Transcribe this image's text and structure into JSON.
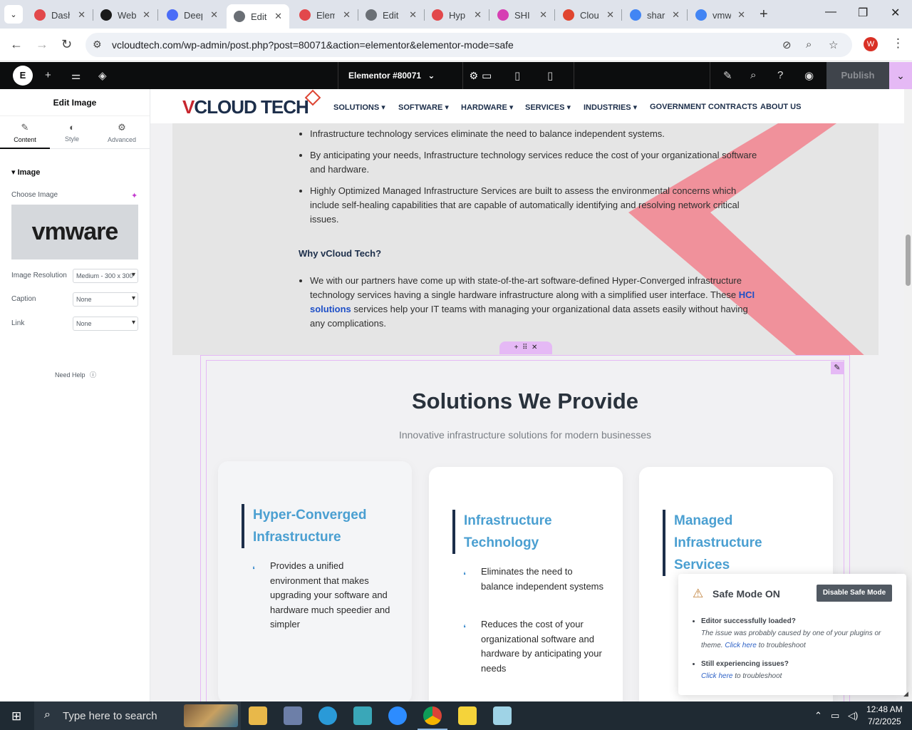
{
  "browser": {
    "tabs": [
      {
        "title": "Dashboard",
        "color": "#e2484b"
      },
      {
        "title": "Web",
        "color": "#1a1a1a"
      },
      {
        "title": "Deep",
        "color": "#4a6cf7"
      },
      {
        "title": "Edit",
        "color": "#6a6f75",
        "active": true
      },
      {
        "title": "Elem",
        "color": "#e2484b"
      },
      {
        "title": "Edit",
        "color": "#6a6f75"
      },
      {
        "title": "Hyp",
        "color": "#e2484b"
      },
      {
        "title": "SHI",
        "color": "#d63fb3"
      },
      {
        "title": "Clou",
        "color": "#e0452f"
      },
      {
        "title": "shar",
        "color": "#4285f4"
      },
      {
        "title": "vmw",
        "color": "#4285f4"
      }
    ],
    "url": "vcloudtech.com/wp-admin/post.php?post=80071&action=elementor&elementor-mode=safe",
    "profile_initial": "W"
  },
  "elementor": {
    "doc_title": "Elementor #80071",
    "publish_label": "Publish"
  },
  "panel": {
    "title": "Edit Image",
    "tabs": [
      "Content",
      "Style",
      "Advanced"
    ],
    "section": "Image",
    "choose_image_label": "Choose Image",
    "preview_logo_text": "vmware",
    "fields": [
      {
        "label": "Image Resolution",
        "value": "Medium - 300 x 300"
      },
      {
        "label": "Caption",
        "value": "None"
      },
      {
        "label": "Link",
        "value": "None"
      }
    ],
    "need_help": "Need Help"
  },
  "site": {
    "logo_v": "V",
    "logo_rest": "CLOUD TECH",
    "menu": [
      "SOLUTIONS",
      "SOFTWARE",
      "HARDWARE",
      "SERVICES",
      "INDUSTRIES",
      "GOVERNMENT CONTRACTS",
      "ABOUT US"
    ],
    "bullets_top": [
      "Infrastructure technology services eliminate the need to balance independent systems.",
      "By anticipating your needs, Infrastructure technology services reduce the cost of your organizational software and hardware.",
      "Highly Optimized Managed Infrastructure Services are built to assess the environmental concerns which include self-healing capabilities that are capable of automatically identifying and resolving network critical issues."
    ],
    "why_heading": "Why vCloud Tech?",
    "why_text_before": "We with our partners have come up with state-of-the-art software-defined Hyper-Converged infrastructure technology services having a single hardware infrastructure along with a simplified user interface. These ",
    "why_link": "HCI solutions",
    "why_text_after": " services help your IT teams with managing your organizational data assets easily without having any complications.",
    "solutions_title": "Solutions We Provide",
    "solutions_subtitle": "Innovative infrastructure solutions for modern businesses",
    "cards": [
      {
        "title": "Hyper-Converged Infrastructure",
        "features": [
          "Provides a unified environment that makes upgrading your software and hardware much speedier and simpler"
        ]
      },
      {
        "title": "Infrastructure Technology",
        "features": [
          "Eliminates the need to balance independent systems",
          "Reduces the cost of your organizational software and hardware by anticipating your needs"
        ]
      },
      {
        "title": "Managed Infrastructure Services",
        "features": []
      }
    ]
  },
  "safe_mode": {
    "title": "Safe Mode ON",
    "button": "Disable Safe Mode",
    "item1_head": "Editor successfully loaded?",
    "item1_text": "The issue was probably caused by one of your plugins or theme.",
    "item1_link": "Click here",
    "item1_tail": "to troubleshoot",
    "item2_head": "Still experiencing issues?",
    "item2_link": "Click here",
    "item2_tail": "to troubleshoot"
  },
  "taskbar": {
    "search_placeholder": "Type here to search",
    "time": "12:48 AM",
    "date": "7/2/2025"
  },
  "colors": {
    "accent_pink": "#e5b9f5",
    "brand_red": "#c7262e",
    "brand_navy": "#1c2e4a",
    "card_title_blue": "#4a9fd1"
  }
}
